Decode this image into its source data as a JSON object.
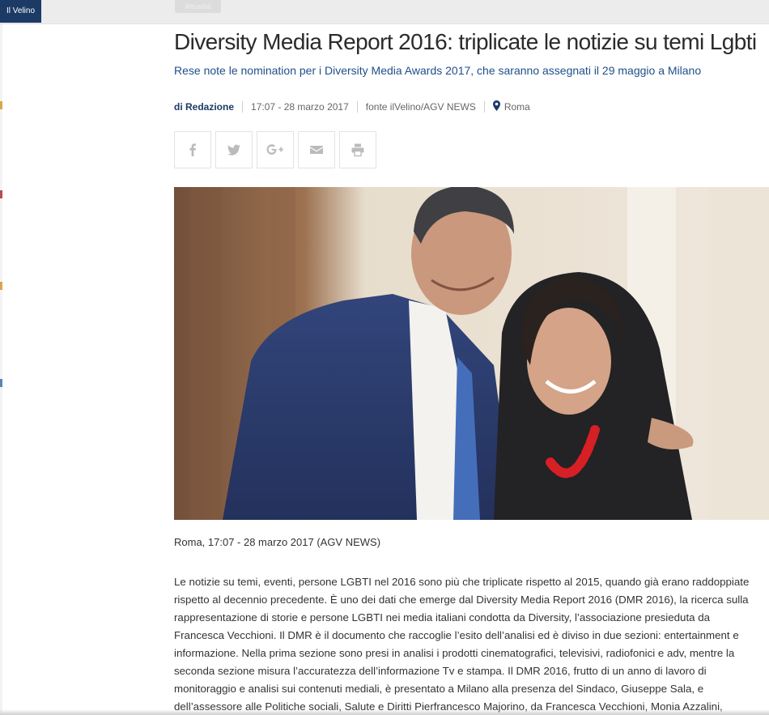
{
  "header": {
    "logo_text": "Il Velino",
    "category_tag": "Attualità"
  },
  "article": {
    "title": "Diversity Media Report 2016: triplicate le notizie su temi Lgbti",
    "subtitle": "Rese note le nomination per i Diversity Media Awards 2017, che saranno assegnati il 29 maggio a Milano",
    "meta": {
      "author": "di Redazione",
      "datetime": "17:07 - 28 marzo 2017",
      "source": "fonte ilVelino/AGV NEWS",
      "location": "Roma"
    },
    "share_buttons": [
      {
        "name": "facebook-icon"
      },
      {
        "name": "twitter-icon"
      },
      {
        "name": "google-plus-icon"
      },
      {
        "name": "email-icon"
      },
      {
        "name": "print-icon"
      }
    ],
    "caption": "Roma, 17:07 - 28 marzo 2017 (AGV NEWS)",
    "body": "Le notizie su temi, eventi, persone LGBTI nel 2016 sono più che triplicate rispetto al 2015, quando già erano raddoppiate rispetto al decennio precedente. È uno dei dati che emerge dal Diversity Media Report 2016 (DMR 2016), la ricerca sulla rappresentazione di storie e persone LGBTI nei media italiani condotta da Diversity, l’associazione presieduta da Francesca Vecchioni. Il DMR è il documento che raccoglie l’esito dell’analisi ed è diviso in due sezioni: entertainment e informazione. Nella prima sezione sono presi in analisi i prodotti cinematografici, televisivi, radiofonici e adv, mentre la seconda sezione misura l’accuratezza dell’informazione Tv e stampa. Il DMR 2016, frutto di un anno di lavoro di monitoraggio e analisi sui contenuti mediali, è presentato a Milano alla presenza del Sindaco, Giuseppe Sala, e dell’assessore alle Politiche sociali, Salute e Diritti Pierfrancesco Majorino, da Francesca Vecchioni, Monia Azzalini,"
  },
  "colors": {
    "brand_navy": "#1b3a66",
    "subtitle_blue": "#1f4f8a"
  }
}
